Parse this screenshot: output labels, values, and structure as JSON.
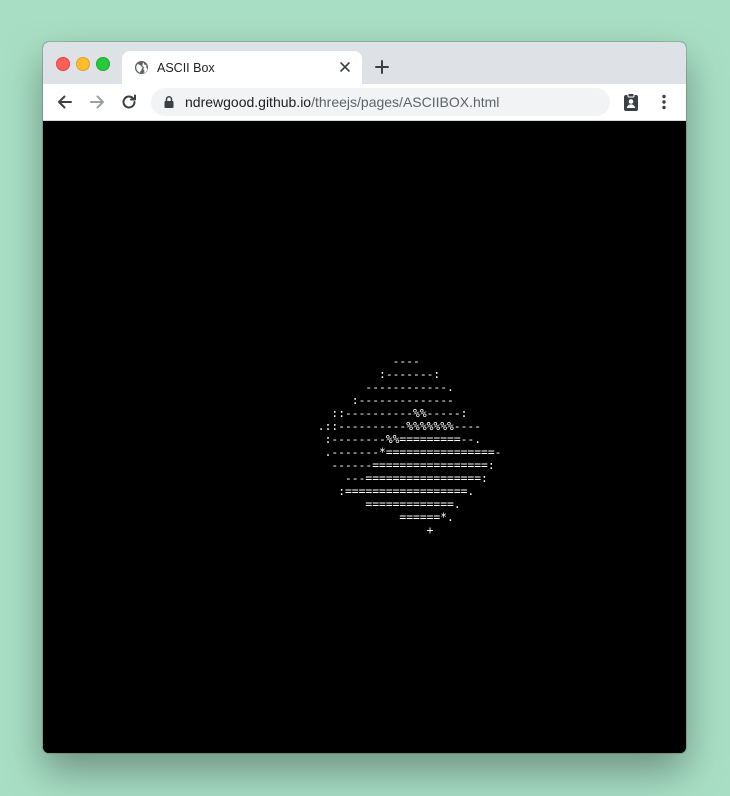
{
  "browser": {
    "tab": {
      "title": "ASCII Box",
      "favicon": "globe-icon"
    },
    "toolbar": {
      "back_icon": "arrow-left-icon",
      "forward_icon": "arrow-right-icon",
      "reload_icon": "reload-icon",
      "extension_icon": "clipboard-user-icon",
      "menu_icon": "kebab-menu-icon"
    },
    "address_bar": {
      "host": "ndrewgood.github.io",
      "path": "/threejs/pages/ASCIIBOX.html",
      "secure_icon": "lock-icon"
    }
  },
  "page": {
    "background": "#000000",
    "ascii_art": [
      "            ----",
      "          :-------:",
      "        ------------.",
      "      :--------------",
      "   ::----------%%-----:",
      " .::----------%%%%%%%----",
      "  :--------%%=========--.",
      "  .-------*================-",
      "   ------=================:",
      "     ---=================:",
      "    :==================.",
      "        =============.",
      "             ======*.",
      "                 +"
    ]
  },
  "colors": {
    "tabstrip": "#dee1e6",
    "omnibox": "#f1f3f4",
    "desktop": "#a8dfc4",
    "traffic_close": "#ff5f57",
    "traffic_minimize": "#febc2e",
    "traffic_maximize": "#28c840"
  }
}
